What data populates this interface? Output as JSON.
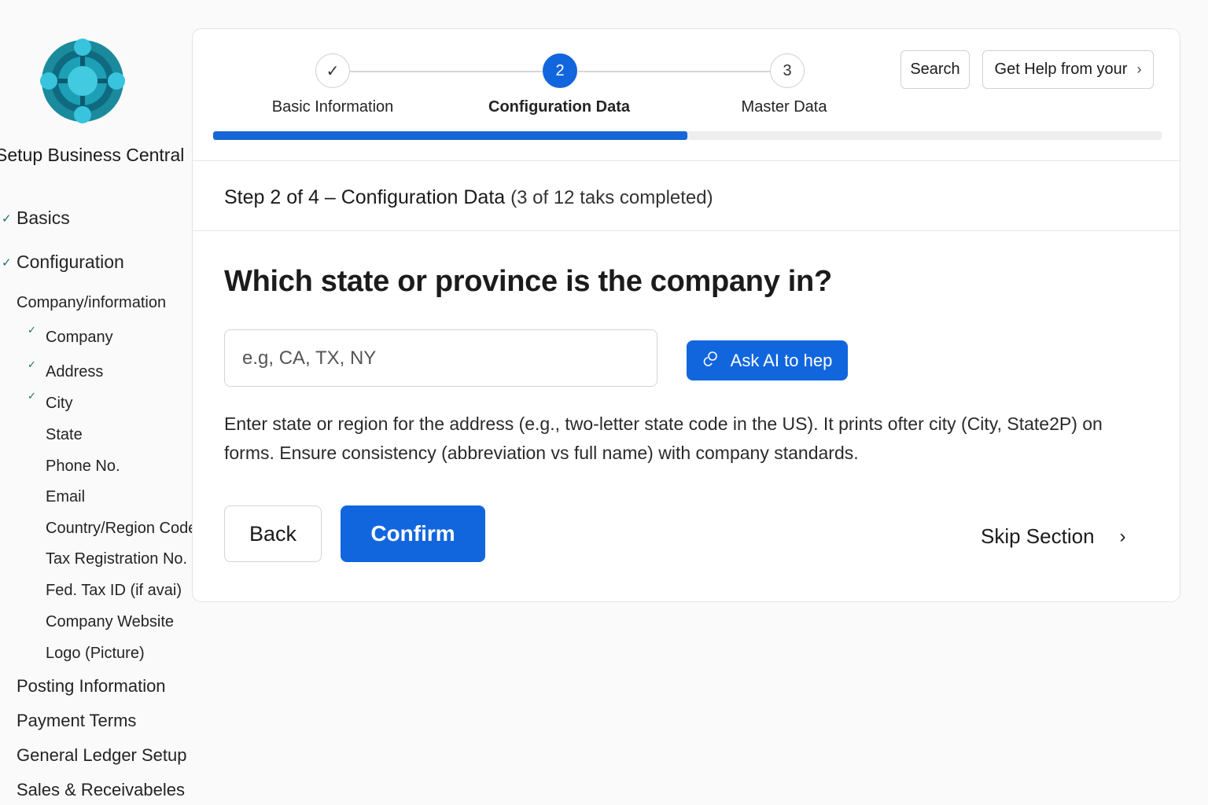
{
  "app": {
    "title": "Setup Business Central"
  },
  "sidebar": {
    "items": [
      {
        "label": "Basics",
        "checked": true
      },
      {
        "label": "Configuration",
        "checked": true
      },
      {
        "label": "Company/information"
      },
      {
        "label": "Company",
        "checked": true
      },
      {
        "label": "Address",
        "checked": true
      },
      {
        "label": "City",
        "checked": true
      },
      {
        "label": "State"
      },
      {
        "label": "Phone No."
      },
      {
        "label": "Email"
      },
      {
        "label": "Country/Region Code"
      },
      {
        "label": "Tax Registration No."
      },
      {
        "label": "Fed. Tax ID (if avai)"
      },
      {
        "label": "Company Website"
      },
      {
        "label": "Logo (Picture)"
      },
      {
        "label": "Posting Information"
      },
      {
        "label": "Payment Terms"
      },
      {
        "label": "General Ledger Setup"
      },
      {
        "label": "Sales & Receivabeles"
      }
    ],
    "check_glyph": "✓"
  },
  "stepper": {
    "steps": [
      {
        "marker": "✓",
        "label": "Basic Information",
        "state": "done"
      },
      {
        "marker": "2",
        "label": "Configuration Data",
        "state": "active"
      },
      {
        "marker": "3",
        "label": "Master Data",
        "state": "pending"
      }
    ],
    "progress_fraction": 0.5
  },
  "toolbar": {
    "search_label": "Search",
    "help_label": "Get Help from your",
    "help_chevron": "›"
  },
  "step_header": {
    "title": "Step 2 of 4 – Configuration Data",
    "status": "(3 of 12 taks completed)"
  },
  "question": {
    "text": "Which state or province is the company in?",
    "placeholder": "e.g, CA, TX, NY",
    "value": "",
    "ai_button_label": "Ask AI to hep",
    "help_text": "Enter state or region for the address (e.g., two-letter state code in the US). It prints ofter city (City, State2P) on forms. Ensure consistency (abbreviation vs full name) with company standards."
  },
  "actions": {
    "back_label": "Back",
    "confirm_label": "Confirm",
    "skip_label": "Skip Section",
    "skip_chevron": "›"
  },
  "colors": {
    "accent": "#1266dd",
    "check": "#1b6a70"
  },
  "icons": {
    "logo": "business-central-logo",
    "ai": "sparkle-icon",
    "chevron": "chevron-right-icon"
  }
}
